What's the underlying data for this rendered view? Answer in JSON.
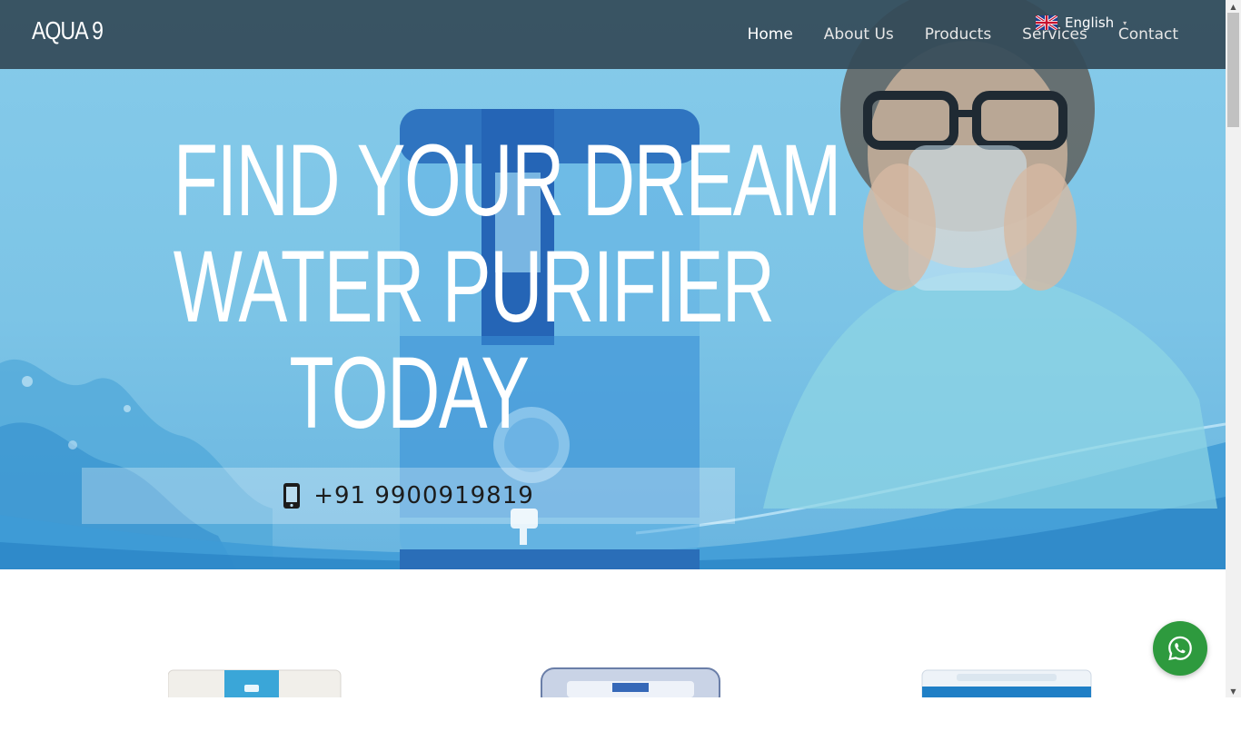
{
  "brand": {
    "logo_text": "AQUA 9"
  },
  "nav": {
    "items": [
      {
        "label": "Home",
        "active": true
      },
      {
        "label": "About Us",
        "active": false
      },
      {
        "label": "Products",
        "active": false
      },
      {
        "label": "Services",
        "active": false
      },
      {
        "label": "Contact",
        "active": false
      }
    ]
  },
  "language": {
    "selected": "English",
    "flag_icon": "uk-flag-icon"
  },
  "hero": {
    "headline_lines": [
      "FIND YOUR DREAM",
      "WATER PURIFIER",
      "TODAY"
    ],
    "phone": "+91 9900919819",
    "phone_icon": "mobile-phone-icon"
  },
  "colors": {
    "navbar": "#344a58",
    "hero_blue": "#7cc4e6",
    "whatsapp_green": "#2e9a3e",
    "text_white": "#ffffff"
  },
  "whatsapp": {
    "icon": "whatsapp-icon"
  }
}
